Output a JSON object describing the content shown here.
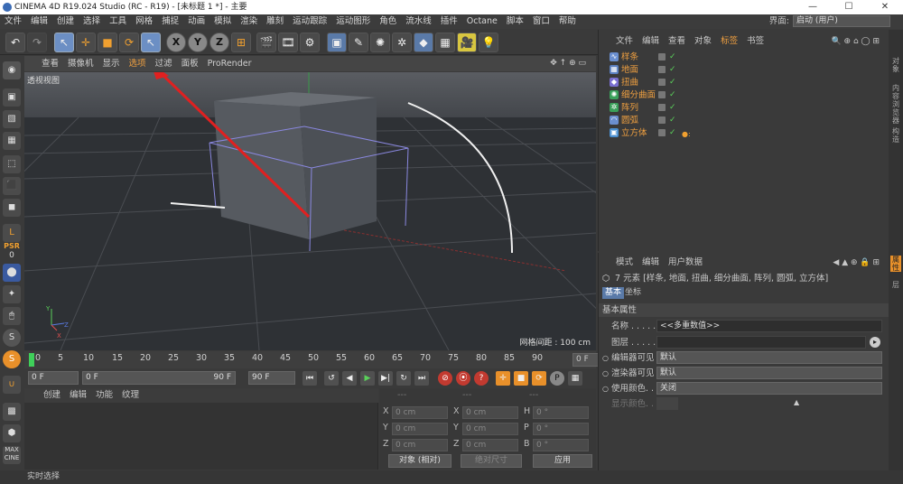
{
  "window": {
    "title": "CINEMA 4D R19.024 Studio (RC - R19) - [未标题 1 *] - 主要",
    "minimize": "—",
    "maximize": "☐",
    "close": "✕"
  },
  "menu": [
    "文件",
    "编辑",
    "创建",
    "选择",
    "工具",
    "网格",
    "捕捉",
    "动画",
    "模拟",
    "渲染",
    "雕刻",
    "运动跟踪",
    "运动图形",
    "角色",
    "流水线",
    "插件",
    "Octane",
    "脚本",
    "窗口",
    "帮助"
  ],
  "interface": {
    "label": "界面:",
    "value": "启动 (用户)"
  },
  "toolbar": {
    "axis_x": "X",
    "axis_y": "Y",
    "axis_z": "Z"
  },
  "left_tools": {
    "psr": "PSR",
    "psr_value": "0"
  },
  "viewport": {
    "menu": [
      "查看",
      "摄像机",
      "显示",
      "选项",
      "过滤",
      "面板",
      "ProRender"
    ],
    "label": "透视视图",
    "grid_info": "网格间距 : 100 cm"
  },
  "timeline": {
    "ticks": [
      "0",
      "5",
      "10",
      "15",
      "20",
      "25",
      "30",
      "35",
      "40",
      "45",
      "50",
      "55",
      "60",
      "65",
      "70",
      "75",
      "80",
      "85",
      "90"
    ],
    "current_frame": "0 F"
  },
  "playback": {
    "start": "0 F",
    "range_start": "0 F",
    "range_end": "90 F",
    "end": "90 F"
  },
  "materials": {
    "menu": [
      "创建",
      "编辑",
      "功能",
      "纹理"
    ]
  },
  "coords": {
    "header": [
      "---",
      "---",
      "---"
    ],
    "rows": [
      {
        "a": "X",
        "av": "0 cm",
        "b": "X",
        "bv": "0 cm",
        "c": "H",
        "cv": "0 °"
      },
      {
        "a": "Y",
        "av": "0 cm",
        "b": "Y",
        "bv": "0 cm",
        "c": "P",
        "cv": "0 °"
      },
      {
        "a": "Z",
        "av": "0 cm",
        "b": "Z",
        "bv": "0 cm",
        "c": "B",
        "cv": "0 °"
      }
    ],
    "mode": "对象 (相对)",
    "size_mode": "绝对尺寸",
    "apply": "应用"
  },
  "objects": {
    "menu": [
      "文件",
      "编辑",
      "查看",
      "对象",
      "标签",
      "书签"
    ],
    "items": [
      {
        "name": "样条",
        "color": "#6a8fd0"
      },
      {
        "name": "地面",
        "color": "#5a7fc0"
      },
      {
        "name": "扭曲",
        "color": "#7a6fd0"
      },
      {
        "name": "细分曲面",
        "color": "#3aa05a"
      },
      {
        "name": "阵列",
        "color": "#3aa05a"
      },
      {
        "name": "圆弧",
        "color": "#6a8fd0"
      },
      {
        "name": "立方体",
        "color": "#4a8fd0"
      }
    ]
  },
  "attributes": {
    "menu": [
      "模式",
      "编辑",
      "用户数据"
    ],
    "summary": "7 元素 [样条, 地面, 扭曲, 细分曲面, 阵列, 圆弧, 立方体]",
    "tabs": [
      "基本",
      "坐标"
    ],
    "section": "基本属性",
    "name_label": "名称 . . . . . . .",
    "name_value": "<<多重数值>>",
    "layer_label": "图层 . . . . . . .",
    "editor_vis_label": "编辑器可见",
    "editor_vis_value": "默认",
    "render_vis_label": "渲染器可见",
    "render_vis_value": "默认",
    "use_color_label": "使用颜色. . . .",
    "use_color_value": "关闭",
    "display_color_label": "显示颜色. . . ."
  },
  "right_strip": [
    "对象",
    "内容浏览器",
    "构造",
    "属性",
    "层"
  ],
  "status": "实时选择"
}
